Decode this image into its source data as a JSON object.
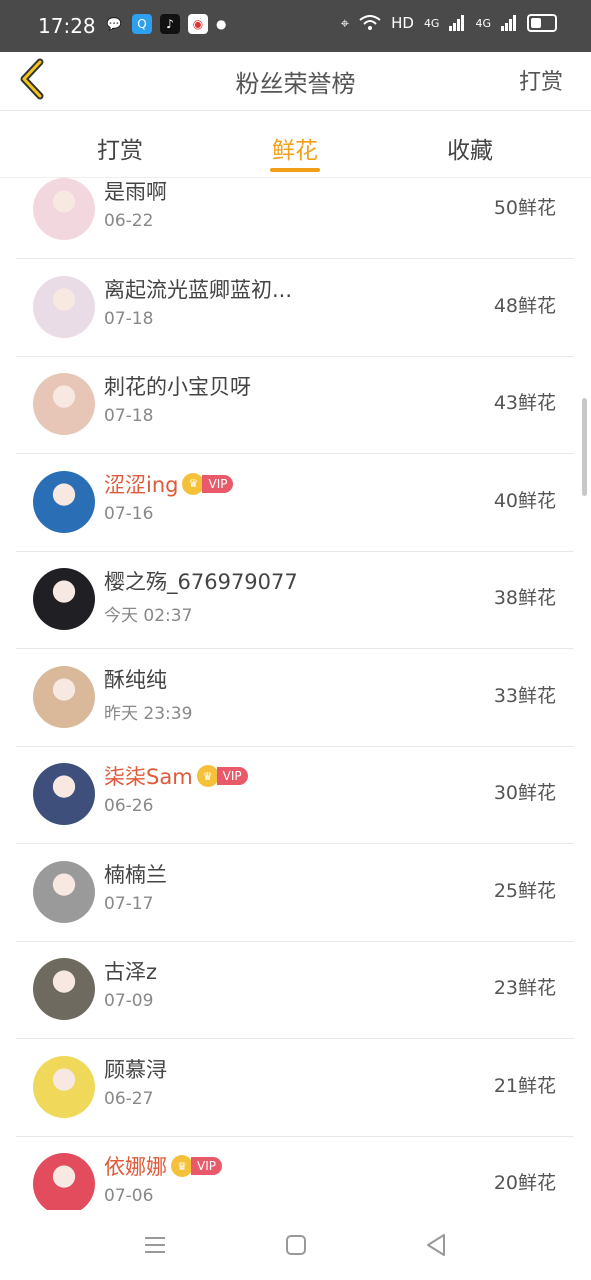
{
  "status_bar": {
    "time": "17:28",
    "apps": [
      "wechat-icon",
      "qq-icon",
      "tiktok-icon",
      "netease-icon"
    ],
    "network_label": "HD",
    "signal1": "4G",
    "signal2": "4G"
  },
  "header": {
    "title": "粉丝荣誉榜",
    "action": "打赏"
  },
  "tabs": [
    {
      "label": "打赏",
      "active": false
    },
    {
      "label": "鲜花",
      "active": true
    },
    {
      "label": "收藏",
      "active": false
    }
  ],
  "accent_color": "#f2a019",
  "vip_name_color": "#e05a3a",
  "vip_badge": "VIP",
  "rows": [
    {
      "name": "是雨啊",
      "date": "06-22",
      "amount": "50鲜花",
      "vip": false,
      "avatar_color": "#f3d7df"
    },
    {
      "name": "离起流光蓝卿蓝初...",
      "date": "07-18",
      "amount": "48鲜花",
      "vip": false,
      "avatar_color": "#e9dce6"
    },
    {
      "name": "刺花的小宝贝呀",
      "date": "07-18",
      "amount": "43鲜花",
      "vip": false,
      "avatar_color": "#e8c6b7"
    },
    {
      "name": "涩涩ing",
      "date": "07-16",
      "amount": "40鲜花",
      "vip": true,
      "avatar_color": "#2a6fb5"
    },
    {
      "name": "樱之殇_676979077",
      "date": "今天 02:37",
      "amount": "38鲜花",
      "vip": false,
      "avatar_color": "#1f1f24"
    },
    {
      "name": "酥纯纯",
      "date": "昨天 23:39",
      "amount": "33鲜花",
      "vip": false,
      "avatar_color": "#d9b99a"
    },
    {
      "name": "柒柒Sam",
      "date": "06-26",
      "amount": "30鲜花",
      "vip": true,
      "avatar_color": "#3d4f7a"
    },
    {
      "name": "楠楠兰",
      "date": "07-17",
      "amount": "25鲜花",
      "vip": false,
      "avatar_color": "#9a9a9a"
    },
    {
      "name": "古泽z",
      "date": "07-09",
      "amount": "23鲜花",
      "vip": false,
      "avatar_color": "#6f6a5f"
    },
    {
      "name": "顾慕浔",
      "date": "06-27",
      "amount": "21鲜花",
      "vip": false,
      "avatar_color": "#f0d95a"
    },
    {
      "name": "依娜娜",
      "date": "07-06",
      "amount": "20鲜花",
      "vip": true,
      "avatar_color": "#e24c5d"
    }
  ]
}
